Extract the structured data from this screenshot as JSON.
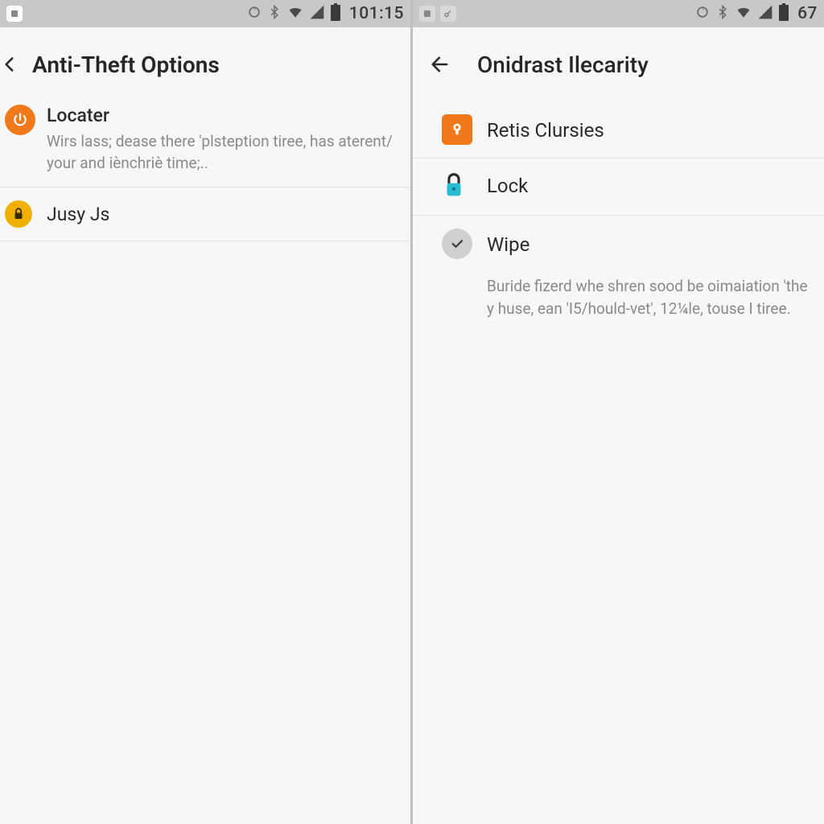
{
  "left": {
    "statusbar": {
      "time": "101:15"
    },
    "appbar": {
      "title": "Anti-Theft Options"
    },
    "items": [
      {
        "icon": "power-icon",
        "title": "Locater",
        "desc": "Wirs lass; dease there 'plsteption tiree, has aterent/ your and iènchriè time;.."
      },
      {
        "icon": "lock-badge-icon",
        "title": "Jusy Js"
      }
    ]
  },
  "right": {
    "statusbar": {
      "time": "67"
    },
    "appbar": {
      "title": "Onidrast Ilecarity"
    },
    "items": [
      {
        "icon": "app-icon",
        "title": "Retis Clursies"
      },
      {
        "icon": "lock-icon",
        "title": "Lock"
      },
      {
        "icon": "check-icon",
        "title": "Wipe"
      }
    ],
    "wipe_desc": "Buride fizerd whe shren sood be oimaiation 'the y huse, ean 'I5/hould-vet', 12¼le, touse I tiree."
  }
}
